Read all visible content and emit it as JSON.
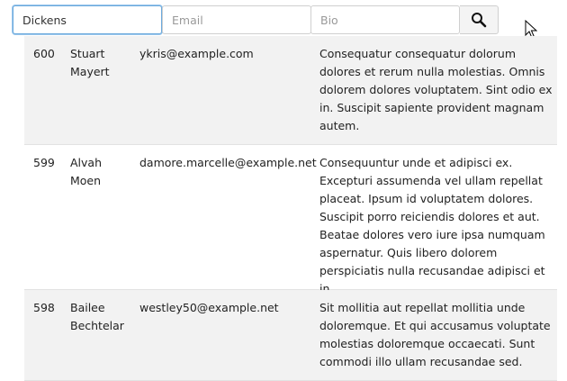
{
  "filters": {
    "name_value": "Dickens",
    "email_placeholder": "Email",
    "bio_placeholder": "Bio"
  },
  "rows": [
    {
      "id": "600",
      "name": "Stuart Mayert",
      "email": "ykris@example.com",
      "bio": "Consequatur consequatur dolorum dolores et rerum nulla molestias. Omnis dolorem dolores voluptatem. Sint odio ex in. Suscipit sapiente provident magnam autem."
    },
    {
      "id": "599",
      "name": "Alvah Moen",
      "email": "damore.marcelle@example.net",
      "bio": "Consequuntur unde et adipisci ex. Excepturi assumenda vel ullam repellat placeat. Ipsum id voluptatem dolores. Suscipit porro reiciendis dolores et aut. Beatae dolores vero iure ipsa numquam aspernatur. Quis libero dolorem perspiciatis nulla recusandae adipisci et in."
    },
    {
      "id": "598",
      "name": "Bailee Bechtelar",
      "email": "westley50@example.net",
      "bio": "Sit mollitia aut repellat mollitia unde doloremque. Et qui accusamus voluptate molestias doloremque occaecati. Sunt commodi illo ullam recusandae sed."
    }
  ]
}
